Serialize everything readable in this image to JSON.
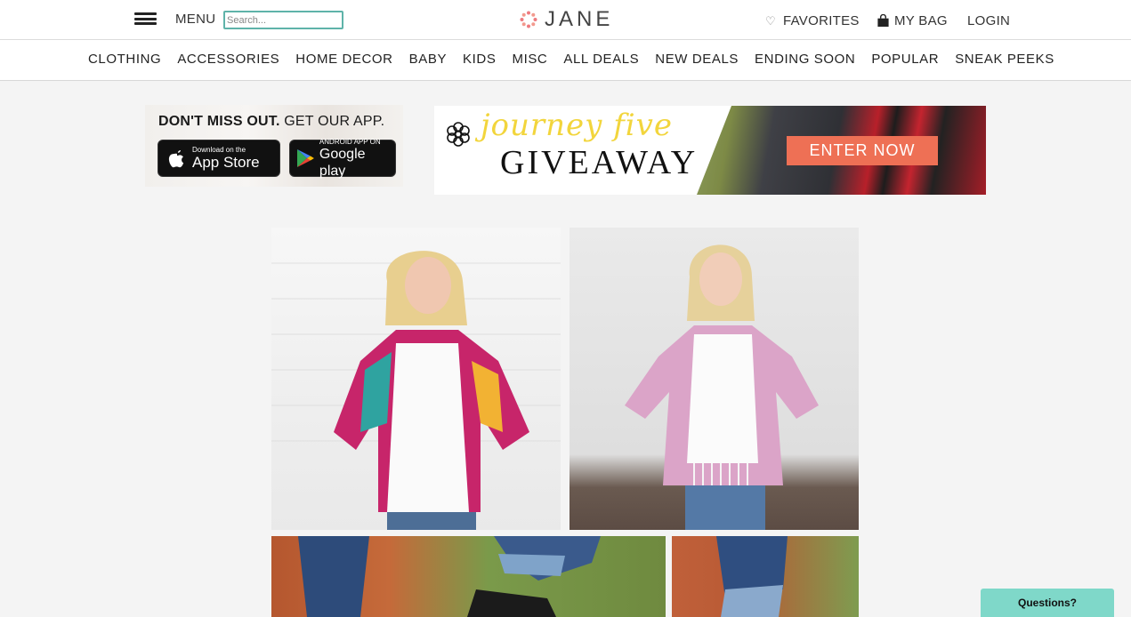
{
  "header": {
    "menu_label": "MENU",
    "search_placeholder": "Search...",
    "logo_text": "JANE",
    "favorites_label": "FAVORITES",
    "bag_label": "MY BAG",
    "login_label": "LOGIN"
  },
  "categories": [
    "CLOTHING",
    "ACCESSORIES",
    "HOME DECOR",
    "BABY",
    "KIDS",
    "MISC",
    "ALL DEALS",
    "NEW DEALS",
    "ENDING SOON",
    "POPULAR",
    "SNEAK PEEKS"
  ],
  "app_banner": {
    "title_bold": "DON'T MISS OUT.",
    "title_rest": "GET OUR APP.",
    "appstore_small": "Download on the",
    "appstore_big": "App Store",
    "googleplay_small": "ANDROID APP ON",
    "googleplay_big": "Google play"
  },
  "giveaway": {
    "script": "journey five",
    "main": "GIVEAWAY",
    "button": "ENTER NOW"
  },
  "chat": {
    "label": "Questions?"
  },
  "colors": {
    "accent_teal": "#5fb3a9",
    "logo_pink": "#ee7b80",
    "enter_button": "#ee7055",
    "giveaway_yellow": "#f2d53c",
    "chat_button": "#7fd8c9"
  },
  "icons": [
    "hamburger-icon",
    "logo-dots-icon",
    "heart-icon",
    "bag-icon",
    "apple-icon",
    "google-play-icon",
    "flower-icon"
  ]
}
